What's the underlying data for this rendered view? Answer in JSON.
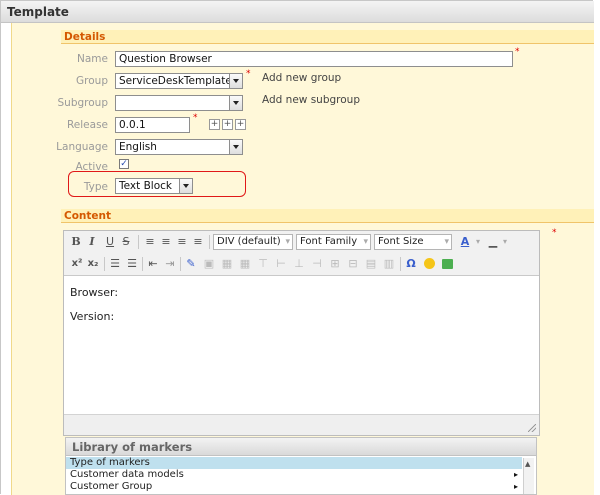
{
  "window": {
    "title": "Template"
  },
  "details": {
    "section_title": "Details",
    "name": {
      "label": "Name",
      "value": "Question Browser"
    },
    "group": {
      "label": "Group",
      "value": "ServiceDeskTemplates",
      "add_link": "Add new group"
    },
    "subgroup": {
      "label": "Subgroup",
      "value": "",
      "add_link": "Add new subgroup"
    },
    "release": {
      "label": "Release",
      "value": "0.0.1",
      "buttons": [
        "+",
        "+",
        "+"
      ]
    },
    "language": {
      "label": "Language",
      "value": "English"
    },
    "active": {
      "label": "Active",
      "checked": true,
      "mark": "✓"
    },
    "type": {
      "label": "Type",
      "value": "Text Block"
    },
    "required_mark": "*"
  },
  "content": {
    "section_title": "Content",
    "toolbar": {
      "bold": "B",
      "italic": "I",
      "underline": "U",
      "strike": "S",
      "format_select": "DIV (default)",
      "font_family": "Font Family",
      "font_size": "Font Size",
      "superscript": "x²",
      "subscript": "x₂",
      "omega": "Ω"
    },
    "lines": [
      "Browser:",
      "Version:"
    ]
  },
  "library": {
    "title": "Library of markers",
    "rows": [
      {
        "label": "Type of markers",
        "selected": true
      },
      {
        "label": "Customer data models",
        "selected": false
      },
      {
        "label": "Customer Group",
        "selected": false
      }
    ],
    "row_arrow": "▸"
  },
  "colors": {
    "section_bg": "#fff1b8",
    "panel_bg": "#fff8d9",
    "section_text": "#d45800",
    "highlight_border": "#e01818",
    "selected_row": "#bfe0ee"
  }
}
